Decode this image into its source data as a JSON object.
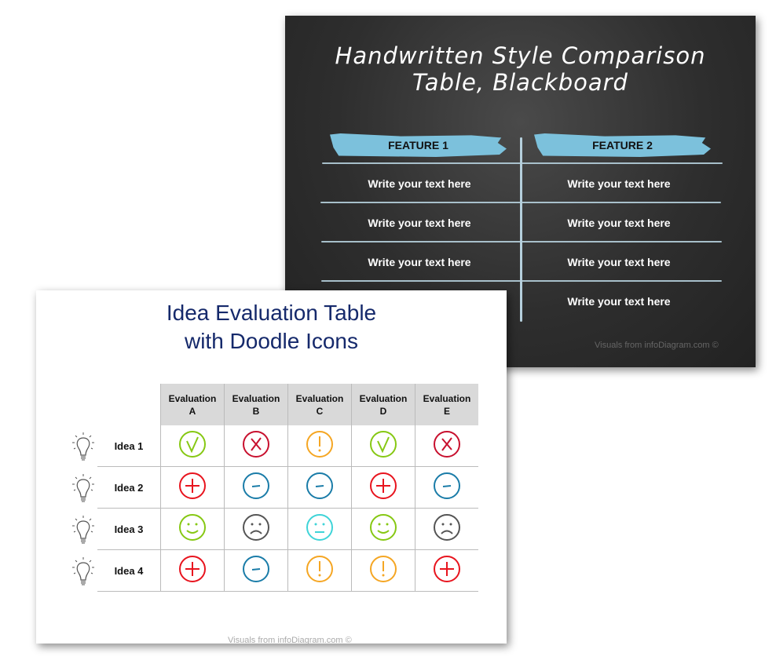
{
  "blackboard": {
    "title_line1": "Handwritten Style Comparison",
    "title_line2": "Table, Blackboard",
    "features": [
      "FEATURE 1",
      "FEATURE 2"
    ],
    "feature_color": "#7cc1dc",
    "col1": [
      "Write your text here",
      "Write your text here",
      "Write your text here"
    ],
    "col2": [
      "Write your text here",
      "Write your text here",
      "Write your text here",
      "Write your text here"
    ],
    "credit": "Visuals from infoDiagram.com ©"
  },
  "evaluation": {
    "title_line1": "Idea Evaluation Table",
    "title_line2": "with Doodle Icons",
    "headers": [
      "Evaluation A",
      "Evaluation B",
      "Evaluation C",
      "Evaluation D",
      "Evaluation E"
    ],
    "rows": [
      {
        "label": "Idea 1",
        "icons": [
          "check",
          "cross",
          "exclamation",
          "check",
          "cross"
        ]
      },
      {
        "label": "Idea 2",
        "icons": [
          "plus",
          "minus",
          "minus",
          "plus",
          "minus"
        ]
      },
      {
        "label": "Idea 3",
        "icons": [
          "smile",
          "sad",
          "neutral",
          "smile",
          "sad"
        ]
      },
      {
        "label": "Idea 4",
        "icons": [
          "plus",
          "minus",
          "exclamation",
          "exclamation",
          "plus"
        ]
      }
    ],
    "icon_colors": {
      "check": "#86c813",
      "cross": "#c8102e",
      "exclamation": "#f5a623",
      "plus": "#e8141e",
      "minus": "#1a7ca8",
      "smile": "#86c813",
      "sad": "#555555",
      "neutral": "#3fd4d8"
    },
    "credit": "Visuals from infoDiagram.com ©"
  }
}
